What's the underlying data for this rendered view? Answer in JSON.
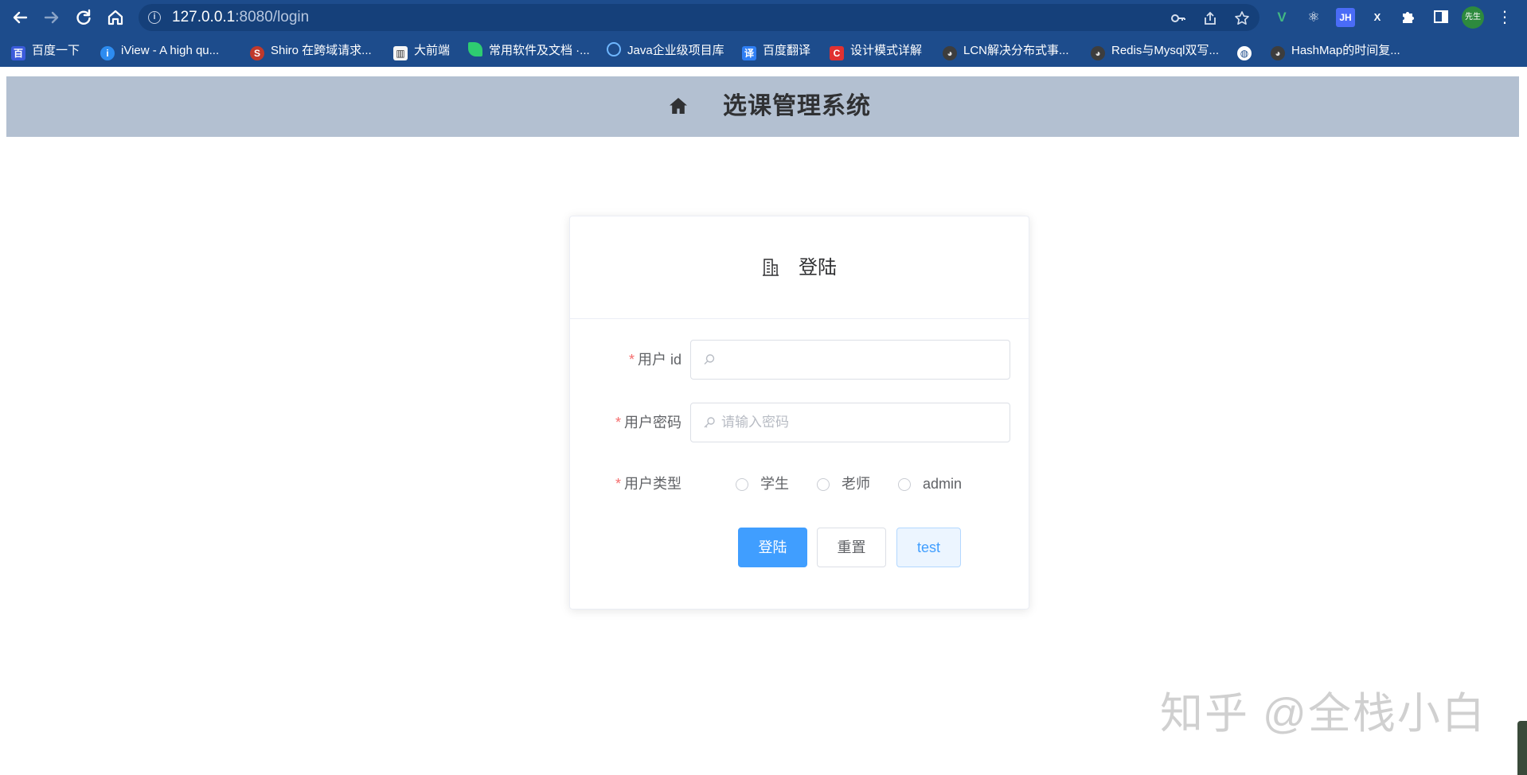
{
  "browser": {
    "url_host": "127.0.0.1",
    "url_path": ":8080/login",
    "avatar_text": "先生",
    "extensions": [
      "V",
      "⚛",
      "JH",
      "X"
    ],
    "bookmarks": [
      {
        "label": "百度一下",
        "icon": "baidu-icon"
      },
      {
        "label": "iView - A high qu...",
        "icon": "iview-icon"
      },
      {
        "label": "Shiro 在跨域请求...",
        "icon": "shiro-icon"
      },
      {
        "label": "大前端",
        "icon": "book-icon"
      },
      {
        "label": "常用软件及文档 ·...",
        "icon": "leaf-icon"
      },
      {
        "label": "Java企业级项目库",
        "icon": "java-icon"
      },
      {
        "label": "百度翻译",
        "icon": "translate-icon"
      },
      {
        "label": "设计模式详解",
        "icon": "c-icon"
      },
      {
        "label": "LCN解决分布式事...",
        "icon": "github-icon"
      },
      {
        "label": "Redis与Mysql双写...",
        "icon": "github-icon"
      },
      {
        "label": "",
        "icon": "globe-icon"
      },
      {
        "label": "HashMap的时间复...",
        "icon": "github-icon"
      }
    ]
  },
  "header": {
    "title": "选课管理系统"
  },
  "login": {
    "title": "登陆",
    "fields": {
      "user_id": {
        "label": "用户 id",
        "value": "",
        "placeholder": ""
      },
      "password": {
        "label": "用户密码",
        "value": "",
        "placeholder": "请输入密码"
      },
      "user_type": {
        "label": "用户类型",
        "options": [
          "学生",
          "老师",
          "admin"
        ],
        "selected": null
      }
    },
    "buttons": {
      "submit": "登陆",
      "reset": "重置",
      "test": "test"
    }
  },
  "watermark": "知乎 @全栈小白",
  "colors": {
    "chrome": "#1d4c8c",
    "header_bg": "#b3c0d1",
    "primary": "#409eff",
    "required": "#f56c6c"
  }
}
